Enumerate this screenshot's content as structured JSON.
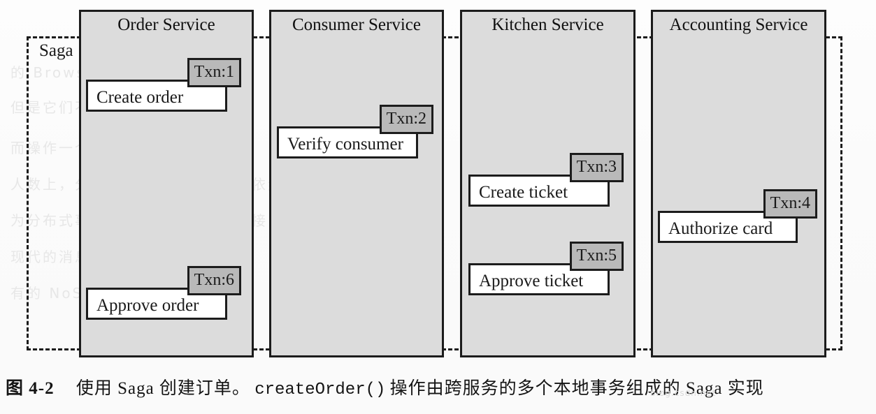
{
  "figure": {
    "kind": "uml-saga-sequence-diagram",
    "saga_label": "Saga",
    "lanes": [
      {
        "id": "order",
        "title": "Order Service"
      },
      {
        "id": "consumer",
        "title": "Consumer Service"
      },
      {
        "id": "kitchen",
        "title": "Kitchen Service"
      },
      {
        "id": "accounting",
        "title": "Accounting Service"
      }
    ],
    "transactions": [
      {
        "id": "create-order",
        "lane": "order",
        "tab": "Txn:1",
        "label": "Create order"
      },
      {
        "id": "verify-consumer",
        "lane": "consumer",
        "tab": "Txn:2",
        "label": "Verify consumer"
      },
      {
        "id": "create-ticket",
        "lane": "kitchen",
        "tab": "Txn:3",
        "label": "Create ticket"
      },
      {
        "id": "authorize-card",
        "lane": "accounting",
        "tab": "Txn:4",
        "label": "Authorize card"
      },
      {
        "id": "approve-ticket",
        "lane": "kitchen",
        "tab": "Txn:5",
        "label": "Approve ticket"
      },
      {
        "id": "approve-order",
        "lane": "order",
        "tab": "Txn:6",
        "label": "Approve order"
      }
    ],
    "colors": {
      "lane_fill": "#dcdcdc",
      "tab_fill": "#b9b9b9",
      "node_fill": "#ffffff",
      "stroke": "#1c1c1c",
      "page": "#ffffff"
    }
  },
  "caption": {
    "figure_number": "图 4-2",
    "text_before_code": "使用 Saga 创建订单。",
    "code": "createOrder()",
    "text_after_code": "操作由跨服务的多个本地事务组成的 Saga 实现",
    "watermark": "blog.csdn.net"
  },
  "ghost_text": {
    "g1": "的 Browser 和 Web",
    "g2": "但是它们不同程序间的",
    "g3": "而操作一个作用是存放在文件",
    "g4": "人数上，分布式事务在很多应用中依然有其用武之地",
    "g5": "为分布式事务提供了一个标准化的接口",
    "g6": "现代的消息代理也不支持它",
    "g7": "有的 NoSQL 数据库"
  }
}
